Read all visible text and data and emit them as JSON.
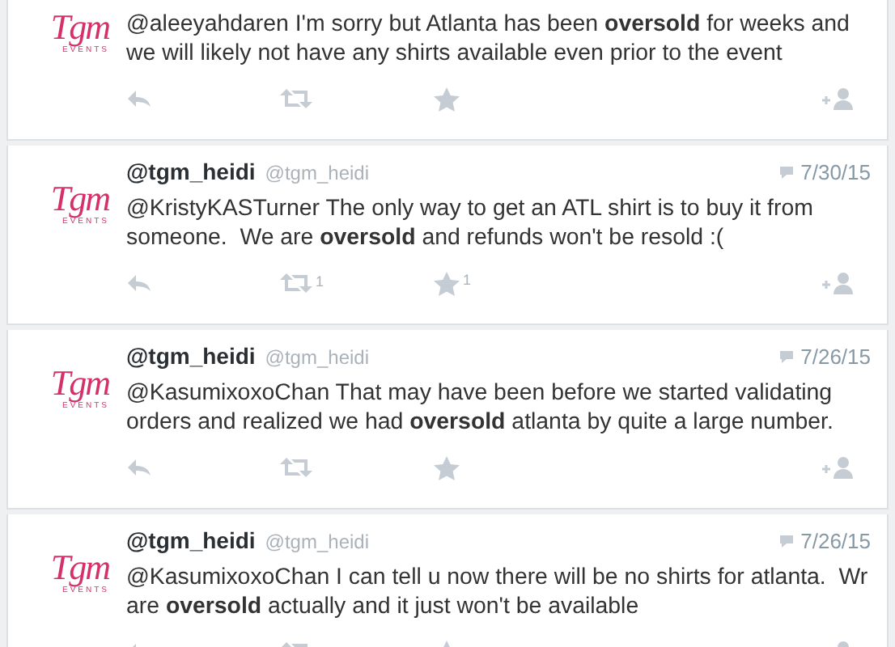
{
  "tweets": [
    {
      "logo": {
        "script": "Tgm",
        "sub": "EVENTS"
      },
      "text": "@aleeyahdaren I'm sorry but Atlanta has been **oversold** for weeks and we will likely not have any shirts available even prior to the event"
    },
    {
      "logo": {
        "script": "Tgm",
        "sub": "EVENTS"
      },
      "name": "@tgm_heidi",
      "handle": "@tgm_heidi",
      "date": "7/30/15",
      "text": "@KristyKASTurner The only way to get an ATL shirt is to buy it from someone.  We are **oversold** and refunds won't be resold :(",
      "actions": {
        "retweets": "1",
        "favorites": "1"
      }
    },
    {
      "logo": {
        "script": "Tgm",
        "sub": "EVENTS"
      },
      "name": "@tgm_heidi",
      "handle": "@tgm_heidi",
      "date": "7/26/15",
      "text": "@KasumixoxoChan That may have been before we started validating orders and realized we had **oversold** atlanta by quite a large number."
    },
    {
      "logo": {
        "script": "Tgm",
        "sub": "EVENTS"
      },
      "name": "@tgm_heidi",
      "handle": "@tgm_heidi",
      "date": "7/26/15",
      "text": "@KasumixoxoChan I can tell u now there will be no shirts for atlanta.  Wr are **oversold** actually and it just won't be available"
    }
  ]
}
